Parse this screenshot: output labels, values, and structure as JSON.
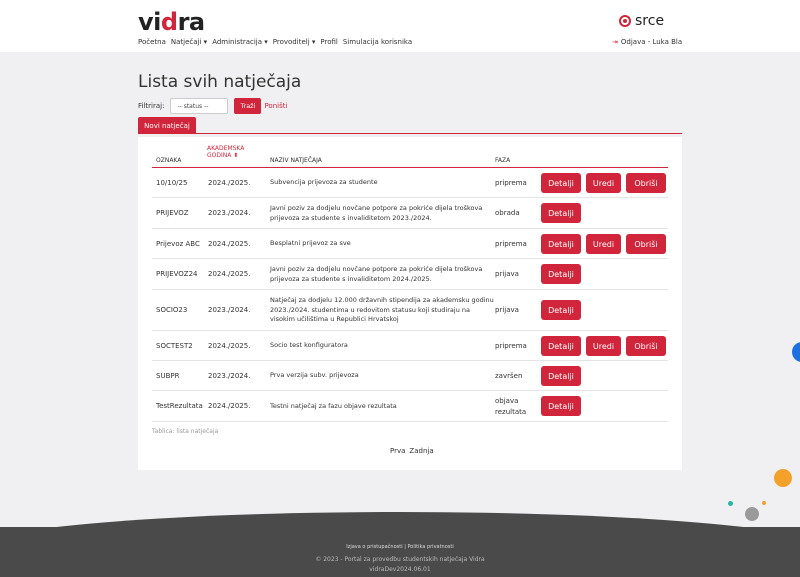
{
  "header": {
    "logo": {
      "pre": "vi",
      "dot": "d",
      "post": "ra"
    },
    "nav": [
      {
        "label": "Početna"
      },
      {
        "label": "Natječaji ▾"
      },
      {
        "label": "Administracija ▾"
      },
      {
        "label": "Provoditelj ▾"
      },
      {
        "label": "Profil"
      },
      {
        "label": "Simulacija korisnika"
      }
    ],
    "brand_text": "srce",
    "logout_label": "Odjava - Luka Bla"
  },
  "page": {
    "title": "Lista svih natječaja",
    "filter_label": "Filtriraj:",
    "status_placeholder": "-- status --",
    "search_button": "Traži",
    "reset_link": "Poništi",
    "new_button": "Novi natječaj"
  },
  "table": {
    "columns": {
      "oznaka": "OZNAKA",
      "akademska_1": "AKADEMSKA",
      "akademska_2": "GODINA ⬍",
      "naziv": "NAZIV NATJEČAJA",
      "faza": "FAZA"
    },
    "rows": [
      {
        "oznaka": "10/10/25",
        "godina": "2024./2025.",
        "naziv": "Subvencija prijevoza za studente",
        "faza": "priprema",
        "detalji": "Detalji",
        "uredi": "Uredi",
        "obrisi": "Obriši"
      },
      {
        "oznaka": "PRIJEVOZ",
        "godina": "2023./2024.",
        "naziv": "Javni poziv za dodjelu novčane potpore za pokriće dijela troškova prijevoza za studente s invaliditetom 2023./2024.",
        "faza": "obrada",
        "detalji": "Detalji"
      },
      {
        "oznaka": "Prijevoz ABC",
        "godina": "2024./2025.",
        "naziv": "Besplatni prijevoz za sve",
        "faza": "priprema",
        "detalji": "Detalji",
        "uredi": "Uredi",
        "obrisi": "Obriši"
      },
      {
        "oznaka": "PRIJEVOZ24",
        "godina": "2024./2025.",
        "naziv": "Javni poziv za dodjelu novčane potpore za pokriće dijela troškova prijevoza za studente s invaliditetom 2024./2025.",
        "faza": "prijava",
        "detalji": "Detalji"
      },
      {
        "oznaka": "SOCIO23",
        "godina": "2023./2024.",
        "naziv": "Natječaj za dodjelu 12.000 državnih stipendija za akademsku godinu 2023./2024. studentima u redovitom statusu koji studiraju na visokim učilištima u Republici Hrvatskoj",
        "faza": "prijava",
        "detalji": "Detalji"
      },
      {
        "oznaka": "SOCTEST2",
        "godina": "2024./2025.",
        "naziv": "Socio test konfiguratora",
        "faza": "priprema",
        "detalji": "Detalji",
        "uredi": "Uredi",
        "obrisi": "Obriši"
      },
      {
        "oznaka": "SUBPR",
        "godina": "2023./2024.",
        "naziv": "Prva verzija subv. prijevoza",
        "faza": "završen",
        "detalji": "Detalji"
      },
      {
        "oznaka": "TestRezultata",
        "godina": "2024./2025.",
        "naziv": "Testni natječaj za fazu objave rezultata",
        "faza": "objava rezultata",
        "detalji": "Detalji"
      }
    ],
    "caption": "Tablica: lista natječaja"
  },
  "pagination": {
    "first": "Prva",
    "last": "Zadnja"
  },
  "footer": {
    "link1": "Izjava o pristupačnosti",
    "separator": "|",
    "link2": "Politika privatnosti",
    "copyright": "© 2023 - Portal za provedbu studentskih natječaja Vidra",
    "version": "vidraDev2024.06.01"
  },
  "colors": {
    "accent": "#d0253a",
    "footer": "#4a4a4a",
    "background": "#f0f0f2"
  }
}
